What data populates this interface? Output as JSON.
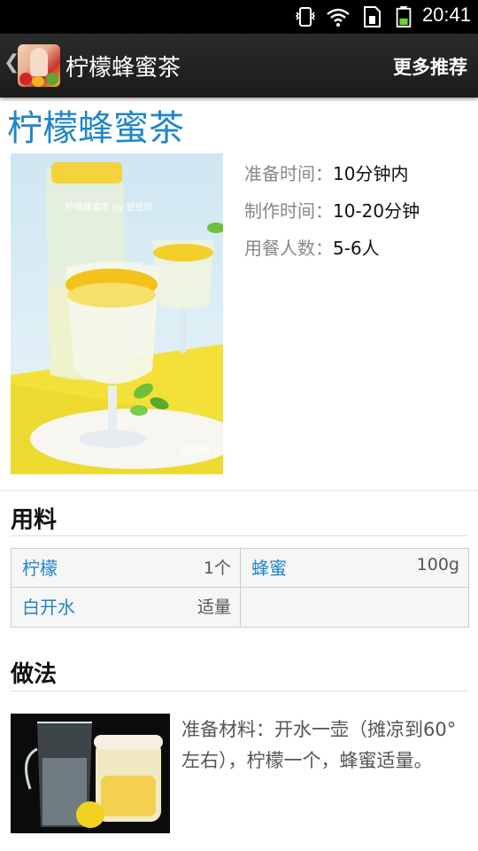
{
  "status_bar": {
    "time": "20:41"
  },
  "action_bar": {
    "title": "柠檬蜂蜜茶",
    "more": "更多推荐"
  },
  "recipe": {
    "title": "柠檬蜂蜜茶",
    "info": [
      {
        "label": "准备时间：",
        "value": "10分钟内"
      },
      {
        "label": "制作时间：",
        "value": "10-20分钟"
      },
      {
        "label": "用餐人数：",
        "value": "5-6人"
      }
    ],
    "hero_watermark": "柠檬蜂蜜茶 by 豆豆妈",
    "hero_logo": "豆果网"
  },
  "ingredients": {
    "title": "用料",
    "items": [
      {
        "name": "柠檬",
        "qty": "1个"
      },
      {
        "name": "蜂蜜",
        "qty": "100g"
      },
      {
        "name": "白开水",
        "qty": "适量"
      }
    ]
  },
  "steps": {
    "title": "做法",
    "items": [
      {
        "text": "准备材料：开水一壶（摊凉到60°左右），柠檬一个，蜂蜜适量。"
      }
    ]
  },
  "colors": {
    "accent": "#1f86c8",
    "actionbar": "#222222"
  }
}
